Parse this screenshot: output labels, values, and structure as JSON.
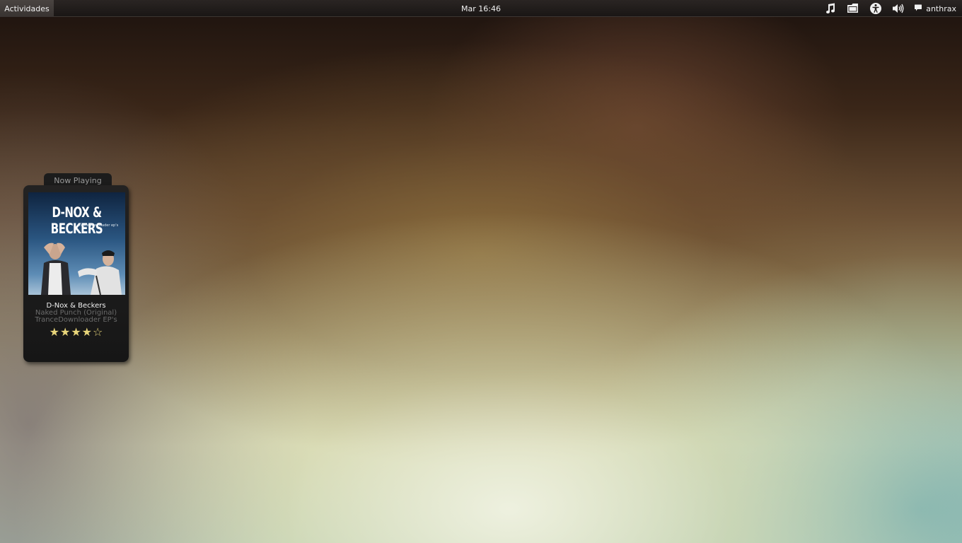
{
  "topbar": {
    "activities_label": "Actividades",
    "clock": "Mar 16:46",
    "user_name": "anthrax",
    "tray_icons": [
      "music-note-icon",
      "folder-icon",
      "accessibility-icon",
      "volume-icon",
      "chat-bubble-icon"
    ]
  },
  "now_playing": {
    "tab_label": "Now Playing",
    "cover_title": "D-NOX & BECKERS",
    "cover_subtitle": "trancedownloader ep's",
    "artist": "D-Nox & Beckers",
    "track": "Naked Punch (Original)",
    "album": "TranceDownloader EP's",
    "rating": 4,
    "rating_max": 5,
    "star_filled": "★",
    "star_empty": "☆",
    "star_color": "#e8d57a"
  },
  "colors": {
    "topbar_bg": "#1a1615",
    "activities_bg": "#403a37",
    "widget_bg": "#1c1c1c"
  }
}
